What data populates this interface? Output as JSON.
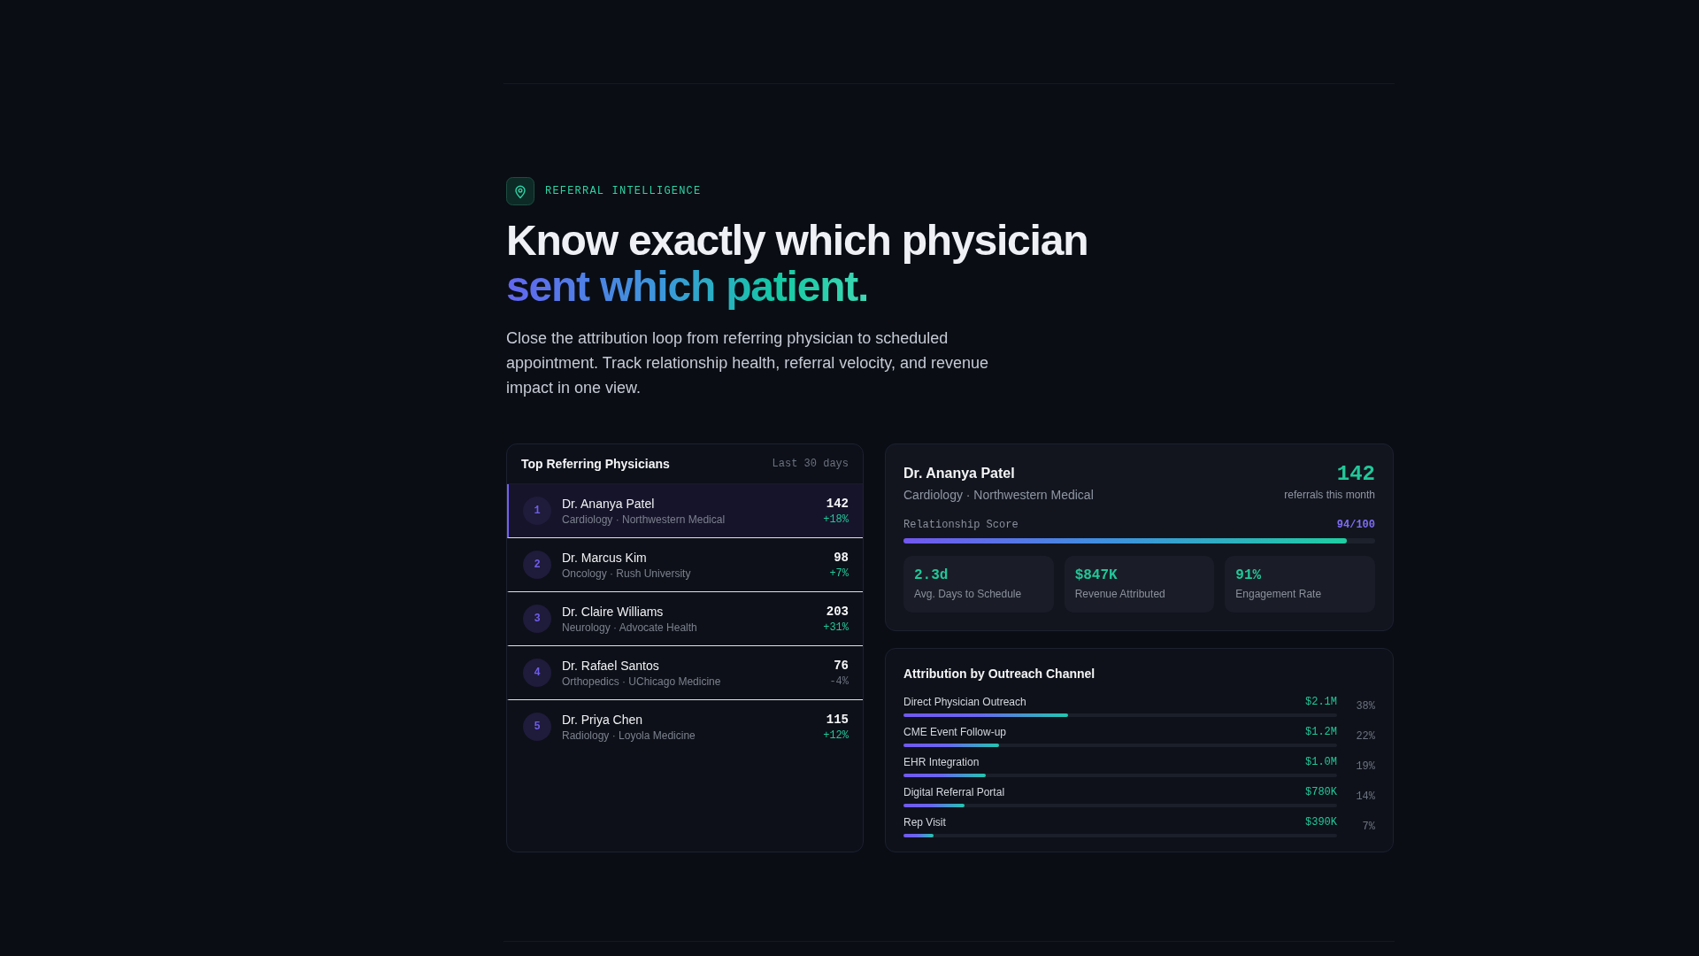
{
  "eyebrow": {
    "label": "REFERRAL INTELLIGENCE"
  },
  "heading": {
    "text": "Know exactly which physician",
    "highlight": "sent which patient."
  },
  "intro": "Close the attribution loop from referring physician to scheduled appointment. Track relationship health, referral velocity, and revenue impact in one view.",
  "physicians": {
    "title": "Top Referring Physicians",
    "period": "Last 30 days",
    "rows": [
      {
        "rank": "1",
        "name": "Dr. Ananya Patel",
        "detail": "Cardiology · Northwestern Medical",
        "count": "142",
        "change": "+18%",
        "positive": true,
        "selected": true
      },
      {
        "rank": "2",
        "name": "Dr. Marcus Kim",
        "detail": "Oncology · Rush University",
        "count": "98",
        "change": "+7%",
        "positive": true,
        "selected": false
      },
      {
        "rank": "3",
        "name": "Dr. Claire Williams",
        "detail": "Neurology · Advocate Health",
        "count": "203",
        "change": "+31%",
        "positive": true,
        "selected": false
      },
      {
        "rank": "4",
        "name": "Dr. Rafael Santos",
        "detail": "Orthopedics · UChicago Medicine",
        "count": "76",
        "change": "-4%",
        "positive": false,
        "selected": false
      },
      {
        "rank": "5",
        "name": "Dr. Priya Chen",
        "detail": "Radiology · Loyola Medicine",
        "count": "115",
        "change": "+12%",
        "positive": true,
        "selected": false
      }
    ]
  },
  "detail": {
    "name": "Dr. Ananya Patel",
    "subtitle": "Cardiology · Northwestern Medical",
    "count": "142",
    "count_label": "referrals this month",
    "score": {
      "label": "Relationship Score",
      "reading": "94/100",
      "level": 0.94
    },
    "stats": [
      {
        "value": "2.3d",
        "label": "Avg. Days to Schedule"
      },
      {
        "value": "$847K",
        "label": "Revenue Attributed"
      },
      {
        "value": "91%",
        "label": "Engagement Rate"
      }
    ]
  },
  "channels": {
    "title": "Attribution by Outreach Channel",
    "rows": [
      {
        "name": "Direct Physician Outreach",
        "value": "$2.1M",
        "share": "38%",
        "level": 0.38
      },
      {
        "name": "CME Event Follow-up",
        "value": "$1.2M",
        "share": "22%",
        "level": 0.22
      },
      {
        "name": "EHR Integration",
        "value": "$1.0M",
        "share": "19%",
        "level": 0.19
      },
      {
        "name": "Digital Referral Portal",
        "value": "$780K",
        "share": "14%",
        "level": 0.14
      },
      {
        "name": "Rep Visit",
        "value": "$390K",
        "share": "7%",
        "level": 0.07
      }
    ]
  }
}
